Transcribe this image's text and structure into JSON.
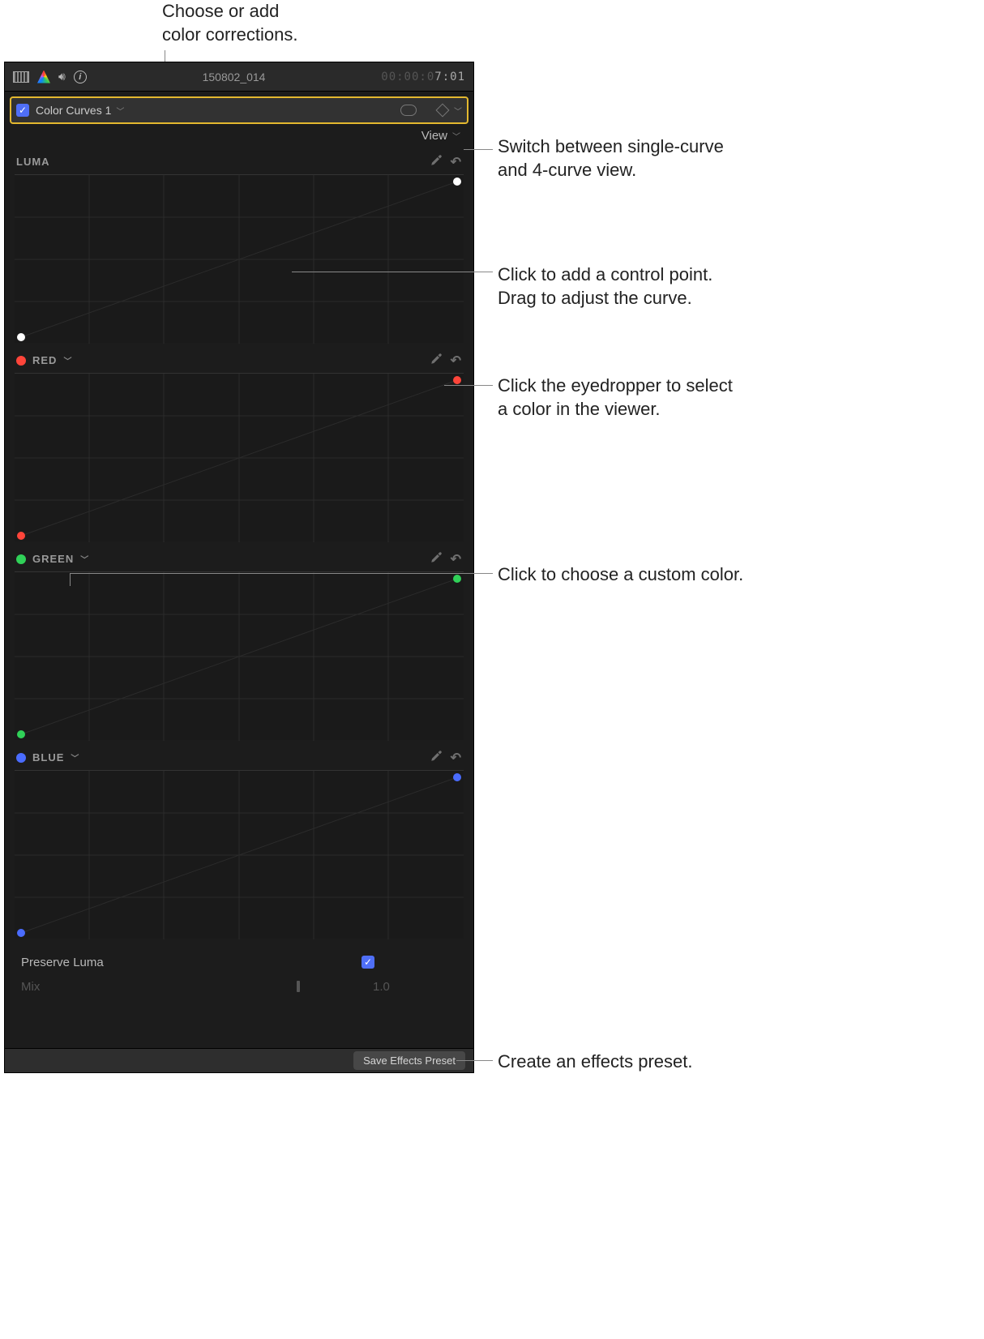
{
  "annotations": {
    "top": "Choose or add\ncolor corrections.",
    "view": "Switch between single-curve\nand 4-curve view.",
    "point": "Click to add a control point.\nDrag to adjust the curve.",
    "eyedrop": "Click the eyedropper to select\na color in the viewer.",
    "custom": "Click to choose a custom color.",
    "preset": "Create an effects preset."
  },
  "toolbar": {
    "clip_name": "150802_014",
    "timecode_prefix": "00:00:0",
    "timecode_end": "7:01"
  },
  "effect": {
    "name": "Color Curves 1"
  },
  "view_label": "View",
  "curves": {
    "luma": {
      "label": "LUMA",
      "color": "#ffffff"
    },
    "red": {
      "label": "RED",
      "color": "#ff453a"
    },
    "green": {
      "label": "GREEN",
      "color": "#30d158"
    },
    "blue": {
      "label": "BLUE",
      "color": "#4a6cff"
    }
  },
  "preserve_luma": {
    "label": "Preserve Luma",
    "checked": true
  },
  "mix": {
    "label": "Mix",
    "value": "1.0"
  },
  "footer": {
    "save_preset": "Save Effects Preset"
  }
}
